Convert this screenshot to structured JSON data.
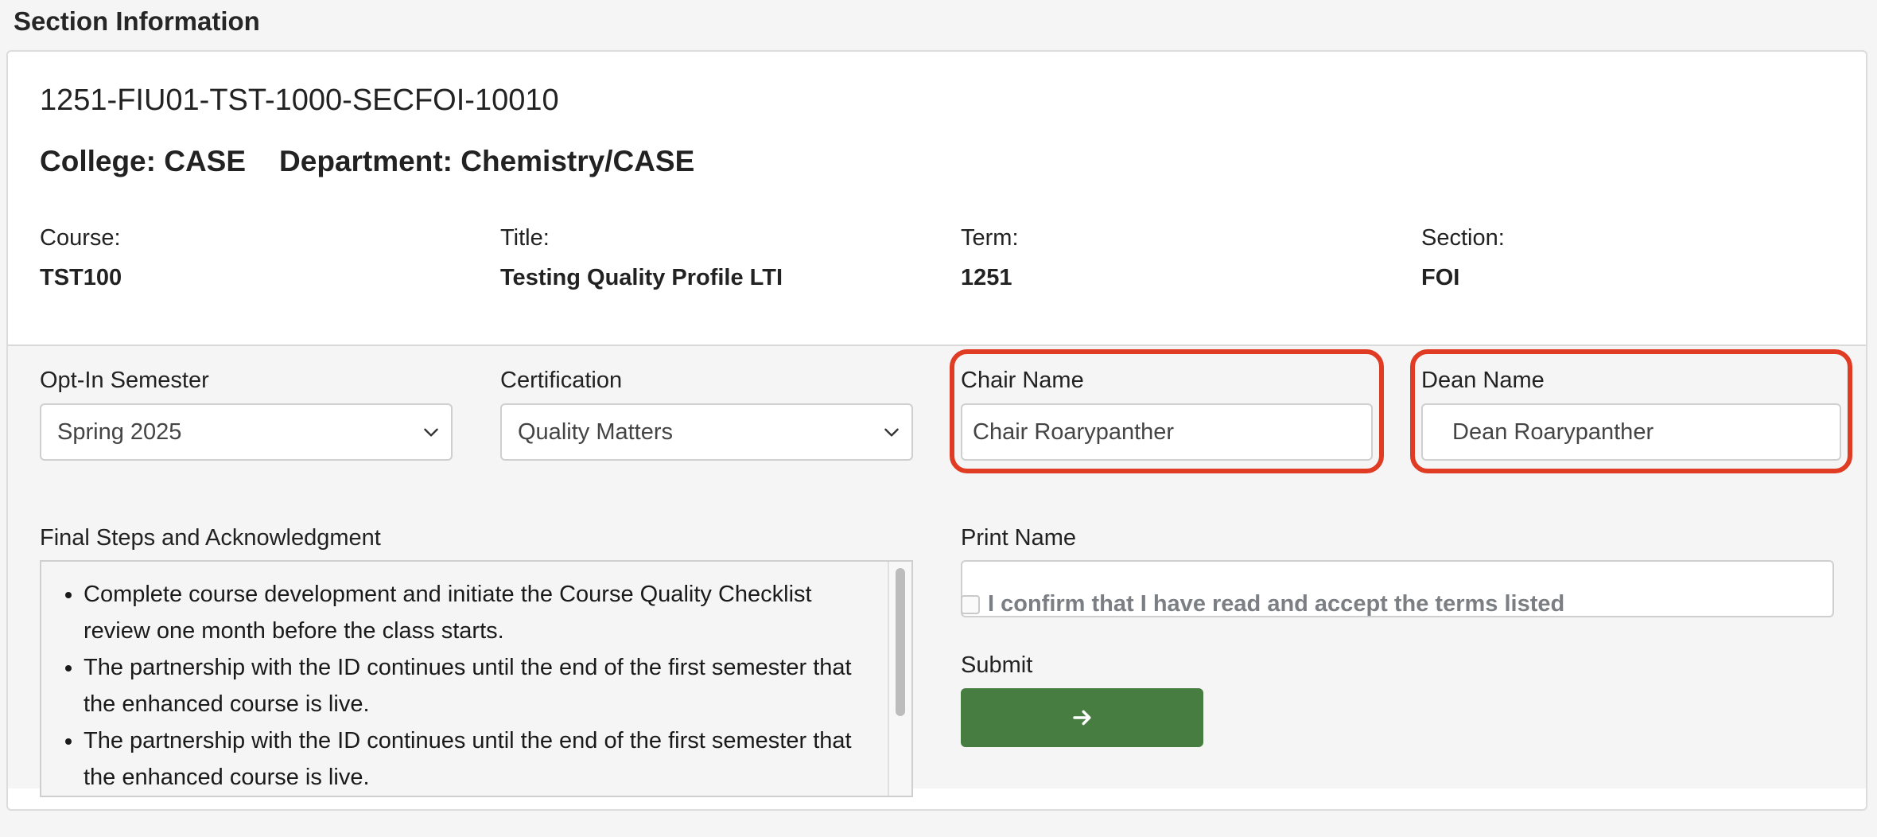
{
  "page": {
    "title": "Section Information"
  },
  "section": {
    "id": "1251-FIU01-TST-1000-SECFOI-10010",
    "college_text": "College: CASE",
    "department_text": "Department: Chemistry/CASE",
    "course_label": "Course:",
    "course_value": "TST100",
    "title_label": "Title:",
    "title_value": "Testing Quality Profile LTI",
    "term_label": "Term:",
    "term_value": "1251",
    "section_label": "Section:",
    "section_value": "FOI"
  },
  "form": {
    "opt_in_label": "Opt-In Semester",
    "opt_in_value": "Spring 2025",
    "certification_label": "Certification",
    "certification_value": "Quality Matters",
    "chair_label": "Chair Name",
    "chair_value": "Chair Roarypanther",
    "dean_label": "Dean Name",
    "dean_value": "Dean Roarypanther",
    "print_label": "Print Name",
    "print_value": "",
    "ack_label": "Final Steps and Acknowledgment",
    "ack_items": [
      "Complete course development and initiate the Course Quality Checklist review one month before the class starts.",
      "The partnership with the ID continues until the end of the first semester that the enhanced course is live.",
      "The partnership with the ID continues until the end of the first semester that the enhanced course is live."
    ],
    "confirm_text": "I confirm that I have read and accept the terms listed",
    "submit_label": "Submit"
  },
  "colors": {
    "highlight": "#e03c24",
    "submit_button": "#477d40"
  },
  "icons": {
    "select_chevron": "chevron-down-icon",
    "submit": "arrow-right-icon"
  }
}
